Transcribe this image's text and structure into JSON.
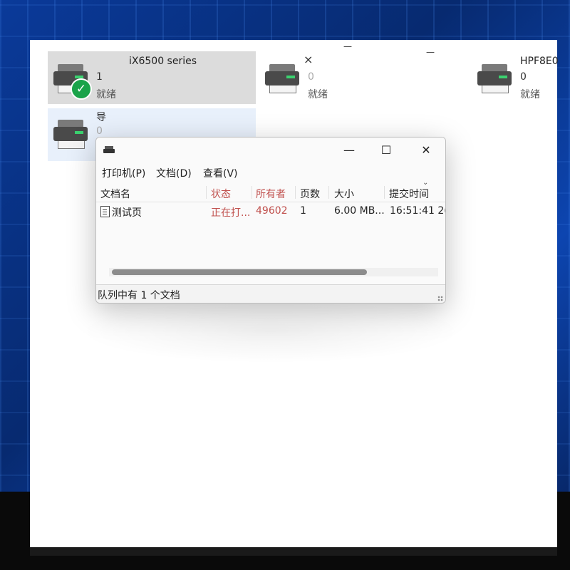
{
  "printers": [
    {
      "name": "iX6500 series",
      "count": "1",
      "status": "就绪",
      "default": true
    },
    {
      "name": "",
      "count": "0",
      "status": "就绪"
    },
    {
      "name": "HPF8E0",
      "count": "0",
      "status": "就绪"
    },
    {
      "name": "导",
      "count": "0",
      "status": ""
    }
  ],
  "stray": {
    "close": "×",
    "minimize_a": "—",
    "minimize_b": "—"
  },
  "queue_window": {
    "title": "",
    "controls": {
      "minimize": "—",
      "maximize": "☐",
      "close": "✕"
    },
    "menu": [
      "打印机(P)",
      "文档(D)",
      "查看(V)"
    ],
    "columns": [
      "文档名",
      "状态",
      "所有者",
      "页数",
      "大小",
      "提交时间"
    ],
    "jobs": [
      {
        "name": "测试页",
        "status": "正在打...",
        "owner": "49602",
        "pages": "1",
        "size": "6.00 MB...",
        "submitted": "16:51:41 2("
      }
    ],
    "status_bar": "队列中有 1 个文档"
  },
  "colors": {
    "status_col": "#c0504d",
    "accent_check": "#1aa34a"
  }
}
